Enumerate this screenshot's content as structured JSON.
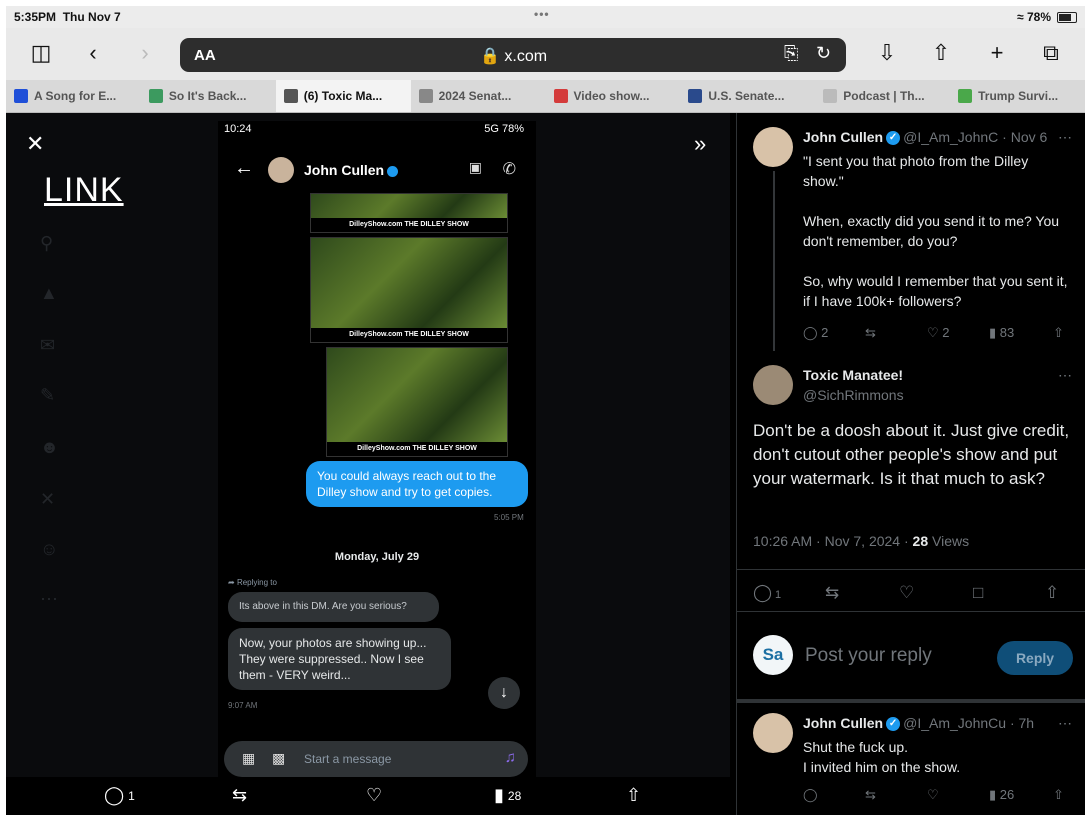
{
  "status_bar": {
    "time": "5:35PM",
    "date": "Thu Nov 7",
    "center_dots": "•••",
    "battery": "78%"
  },
  "toolbar": {
    "aa_label": "AA",
    "url": "x.com"
  },
  "tabs": [
    {
      "title": "A Song for E...",
      "color": "#1f4fd8"
    },
    {
      "title": "So It's Back...",
      "color": "#3c9a5f"
    },
    {
      "title": "(6) Toxic Ma...",
      "color": "#555555"
    },
    {
      "title": "2024 Senat...",
      "color": "#888888"
    },
    {
      "title": "Video show...",
      "color": "#d43b3b"
    },
    {
      "title": "U.S. Senate...",
      "color": "#2a4a8c"
    },
    {
      "title": "Podcast | Th...",
      "color": "#bbbbbb"
    },
    {
      "title": "Trump Survi...",
      "color": "#4aa84a"
    }
  ],
  "overlay": {
    "link_text": "LINK"
  },
  "dm": {
    "status_time": "10:24",
    "status_right": "5G 78%",
    "contact_name": "John Cullen",
    "photo_caption": "DilleyShow.com   THE DILLEY SHOW",
    "my_message": "You could always reach out to the Dilley show and try to get copies.",
    "my_time": "5:05 PM",
    "date_divider": "Monday, July 29",
    "replying_to": "Replying to",
    "reply_quote": "Its above in this DM. Are you serious?",
    "their_message": "Now, your photos are showing up... They were suppressed.. Now I see them - VERY weird...",
    "their_time": "9:07 AM",
    "compose_placeholder": "Start a message"
  },
  "bottom_bar": {
    "reply_count": "1",
    "views": "28"
  },
  "tweets": [
    {
      "name": "John Cullen",
      "handle": "@I_Am_JohnC",
      "time": "· Nov 6",
      "lines": "\"I sent you that photo from the Dilley show.\"\n\nWhen, exactly did you send it to me? You don't remember, do you?\n\nSo, why would I remember that you sent it, if I have 100k+ followers?",
      "replies": "2",
      "likes": "2",
      "views": "83"
    },
    {
      "name": "Toxic Manatee!",
      "handle": "@SichRimmons",
      "text": "Don't be a doosh about it.  Just give credit,  don't cutout other people's show and put your watermark.  Is it that much to ask?",
      "timestamp": "10:26 AM · Nov 7, 2024 ·",
      "views_num": "28",
      "views_label": "Views",
      "replies": "1"
    },
    {
      "name": "John Cullen",
      "handle": "@I_Am_JohnCu",
      "time": "· 7h",
      "lines": "Shut the fuck up.\nI invited him on the show.",
      "views": "26"
    }
  ],
  "reply_box": {
    "avatar_text": "Sa",
    "placeholder": "Post your reply",
    "button": "Reply"
  }
}
